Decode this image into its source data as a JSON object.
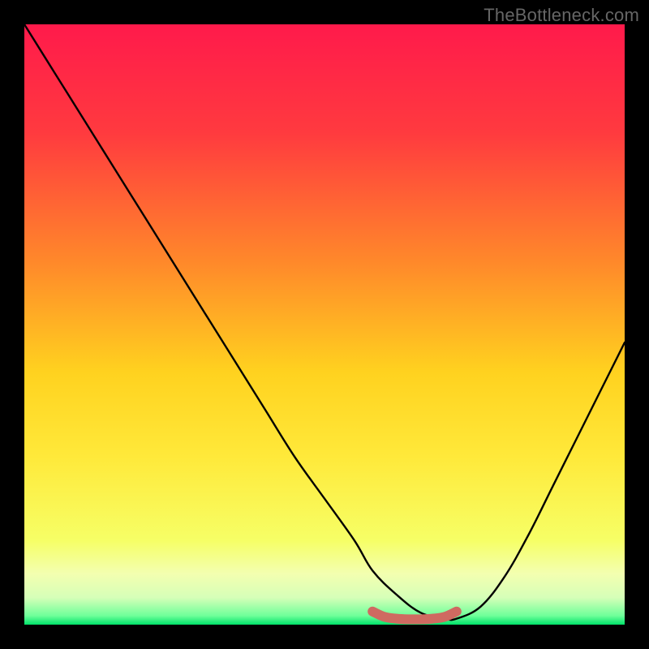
{
  "watermark": "TheBottleneck.com",
  "chart_data": {
    "type": "line",
    "title": "",
    "xlabel": "",
    "ylabel": "",
    "xlim": [
      0,
      100
    ],
    "ylim": [
      0,
      100
    ],
    "gradient_stops": [
      {
        "offset": 0,
        "color": "#ff1a4b"
      },
      {
        "offset": 0.18,
        "color": "#ff3a3f"
      },
      {
        "offset": 0.4,
        "color": "#ff8a2a"
      },
      {
        "offset": 0.58,
        "color": "#ffd21f"
      },
      {
        "offset": 0.72,
        "color": "#ffe93a"
      },
      {
        "offset": 0.86,
        "color": "#f6ff66"
      },
      {
        "offset": 0.915,
        "color": "#f3ffb0"
      },
      {
        "offset": 0.955,
        "color": "#d6ffb8"
      },
      {
        "offset": 0.985,
        "color": "#6fff9a"
      },
      {
        "offset": 1.0,
        "color": "#00e26a"
      }
    ],
    "series": [
      {
        "name": "bottleneck-curve",
        "x": [
          0,
          5,
          10,
          15,
          20,
          25,
          30,
          35,
          40,
          45,
          50,
          55,
          58,
          62,
          66,
          70,
          72,
          76,
          80,
          84,
          88,
          92,
          96,
          100
        ],
        "y": [
          100,
          92,
          84,
          76,
          68,
          60,
          52,
          44,
          36,
          28,
          21,
          14,
          9,
          5,
          2,
          1,
          1,
          3,
          8,
          15,
          23,
          31,
          39,
          47
        ]
      }
    ],
    "highlight_segment": {
      "name": "valley-marker",
      "color": "#cf6a61",
      "x": [
        58,
        60,
        62,
        64,
        66,
        68,
        70,
        72
      ],
      "y": [
        2.2,
        1.3,
        1.0,
        0.9,
        0.9,
        1.0,
        1.3,
        2.2
      ]
    }
  }
}
